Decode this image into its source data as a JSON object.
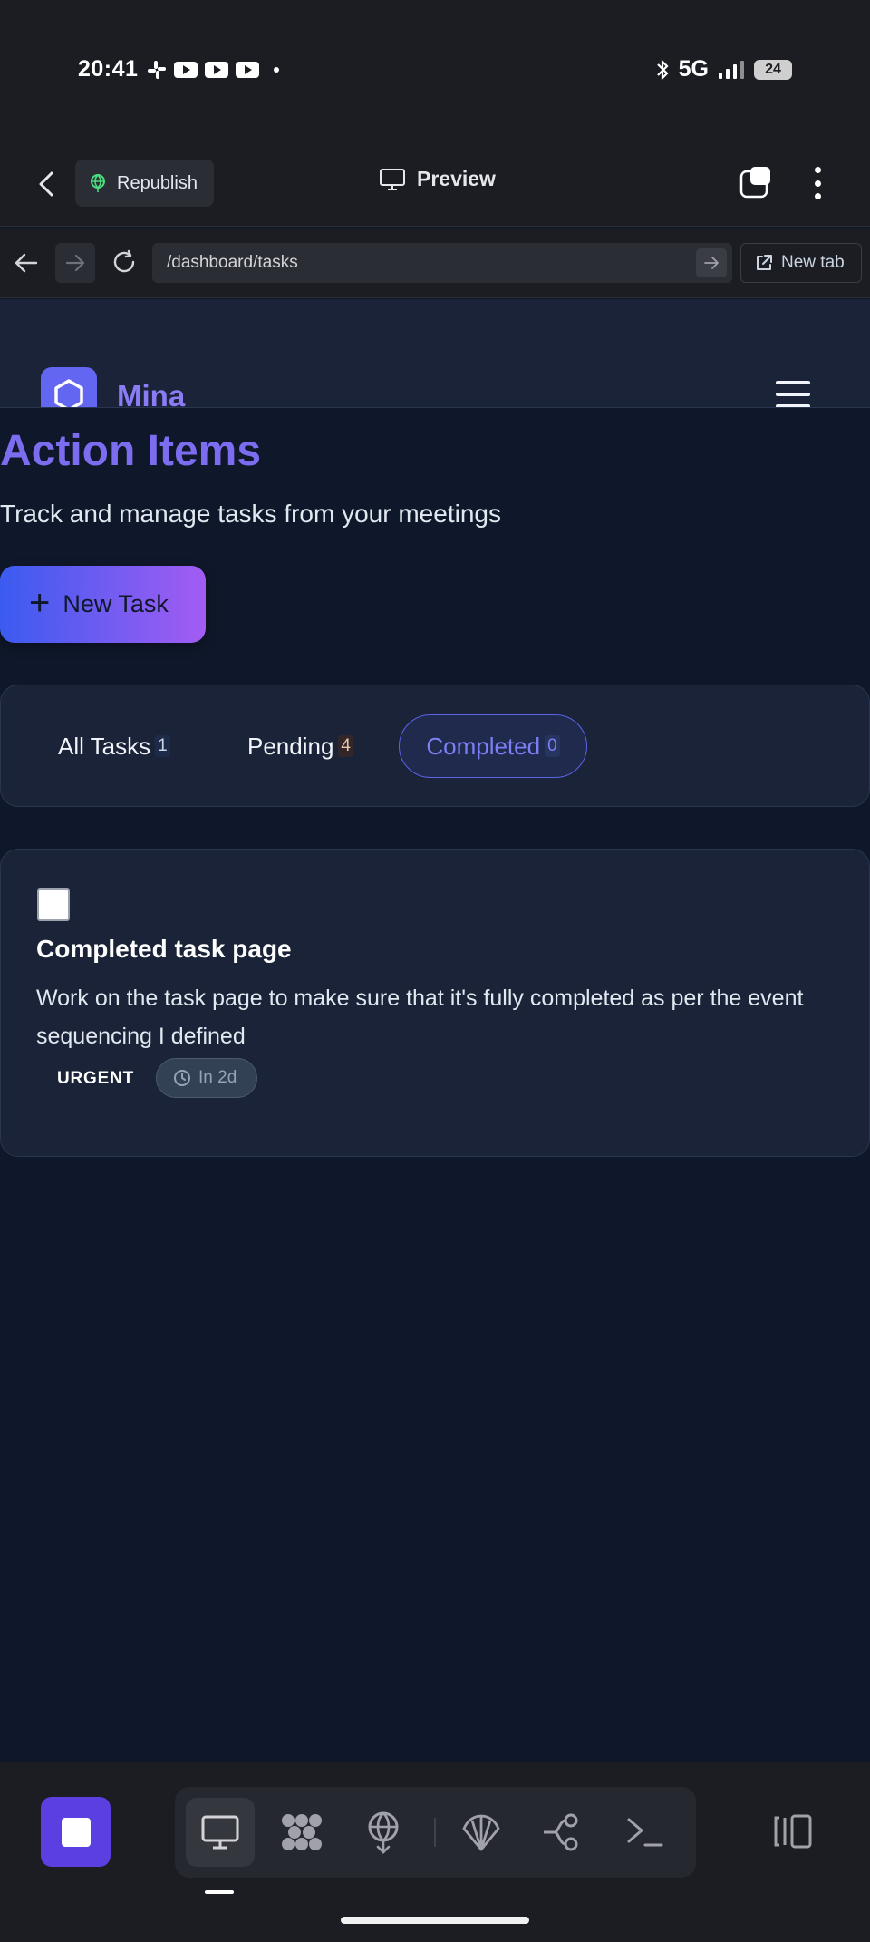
{
  "status_bar": {
    "time": "20:41",
    "network": "5G",
    "battery": "24",
    "icons": [
      "slack-icon",
      "youtube-icon",
      "youtube-icon",
      "youtube-icon",
      "bluetooth-icon",
      "signal-icon"
    ]
  },
  "app_bar": {
    "republish_label": "Republish",
    "preview_label": "Preview"
  },
  "url_bar": {
    "url": "/dashboard/tasks",
    "new_tab_label": "New tab"
  },
  "site": {
    "brand": "Mina",
    "title": "Action Items",
    "subtitle": "Track and manage tasks from your meetings",
    "new_task_label": "New Task"
  },
  "filters": {
    "tabs": [
      {
        "label": "All Tasks",
        "count": "1"
      },
      {
        "label": "Pending",
        "count": "4"
      },
      {
        "label": "Completed",
        "count": "0",
        "active": true
      }
    ]
  },
  "tasks": [
    {
      "title": "Completed task page",
      "description": "Work on the task page to make sure that it's fully completed as per the event sequencing I defined",
      "priority": "URGENT",
      "due": "In 2d",
      "checked": false
    }
  ],
  "colors": {
    "accent": "#7c6cf0",
    "page_bg": "#0f172a",
    "card_bg": "#1a2338",
    "stop_button": "#5b3fe0"
  }
}
